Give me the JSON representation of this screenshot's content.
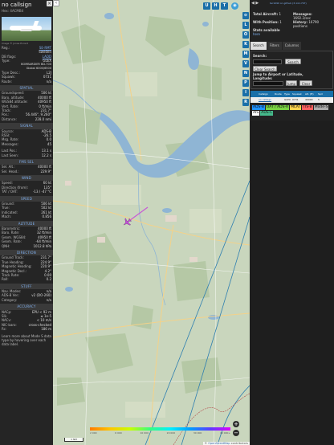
{
  "selected": {
    "callsign": "no callsign",
    "hex_label": "Hex:",
    "hex": "4ACMB4",
    "photo_credit": "Image © Jonas Evrard",
    "reg_label": "Reg.:",
    "reg": "SE-RMT",
    "country": "Sweden",
    "dbflags_label": "DB flags:",
    "dbflags": "LADD",
    "type_label": "Type:",
    "type": "GLEX",
    "typename": "BOMBARDIER BD-700 Global 6000/6500",
    "typedesc_label": "Type Desc.:",
    "typedesc": "L2J",
    "squawk_label": "Squawk:",
    "squawk": "0731",
    "route_label": "Route:",
    "route": "n/a",
    "sec_spatial": "SPATIAL",
    "spatial": [
      {
        "k": "Groundspeed:",
        "v": "506 kt"
      },
      {
        "k": "Baro. altitude:",
        "v": "40000 ft"
      },
      {
        "k": "WGS84 altitude:",
        "v": "40950 ft"
      },
      {
        "k": "Vert. Rate:",
        "v": "0 ft/min"
      },
      {
        "k": "Track:",
        "v": "231.7°"
      },
      {
        "k": "Pos.:",
        "v": "56.446°, 9.260°"
      },
      {
        "k": "Distance:",
        "v": "228.0 nmi"
      }
    ],
    "sec_signal": "SIGNAL",
    "signal": [
      {
        "k": "Source:",
        "v": "ADS-B"
      },
      {
        "k": "RSSI:",
        "v": "-26.5"
      },
      {
        "k": "Msg. Rate:",
        "v": "0.0"
      },
      {
        "k": "Messages:",
        "v": "45"
      }
    ],
    "signal2": [
      {
        "k": "Last Pos.:",
        "v": "13.1 s"
      },
      {
        "k": "Last Seen:",
        "v": "12.2 s"
      }
    ],
    "sec_fms": "FMS SEL",
    "fms": [
      {
        "k": "Sel. Alt.:",
        "v": "40000 ft"
      },
      {
        "k": "Sel. Head.:",
        "v": "229.9°"
      }
    ],
    "sec_wind": "WIND",
    "wind": [
      {
        "k": "Speed:",
        "v": "60 kt"
      },
      {
        "k": "Direction (from):",
        "v": "135°"
      },
      {
        "k": "TAT / OAT:",
        "v": "-13 / -47 °C"
      }
    ],
    "sec_speed": "SPEED",
    "speed": [
      {
        "k": "Ground:",
        "v": "506 kt"
      },
      {
        "k": "True:",
        "v": "502 kt"
      },
      {
        "k": "Indicated:",
        "v": "261 kt"
      },
      {
        "k": "Mach:",
        "v": "0.856"
      }
    ],
    "sec_altitude": "ALTITUDE",
    "altitude": [
      {
        "k": "Barometric:",
        "v": "40000 ft"
      },
      {
        "k": "Baro. Rate:",
        "v": "32 ft/min"
      },
      {
        "k": "Geom. WGS84:",
        "v": "40950 ft"
      },
      {
        "k": "Geom. Rate:",
        "v": "-64 ft/min"
      },
      {
        "k": "QNH:",
        "v": "1012.8 hPa"
      }
    ],
    "sec_direction": "DIRECTION",
    "direction": [
      {
        "k": "Ground Track:",
        "v": "231.7°"
      },
      {
        "k": "True Heading:",
        "v": "224.9°"
      },
      {
        "k": "Magnetic Heading:",
        "v": "220.9°"
      },
      {
        "k": "Magnetic Decl.:",
        "v": "4.2°"
      },
      {
        "k": "Track Rate:",
        "v": "0.00"
      },
      {
        "k": "Roll:",
        "v": "0.2"
      }
    ],
    "sec_stuff": "STUFF",
    "stuff": [
      {
        "k": "Nav. Modes:",
        "v": "n/a"
      },
      {
        "k": "ADS-B Ver.:",
        "v": "v2 (DO-260)"
      },
      {
        "k": "Category:",
        "v": "n/a"
      }
    ],
    "sec_accuracy": "ACCURACY",
    "accuracy": [
      {
        "k": "NACp:",
        "v": "EPU < 92 m"
      },
      {
        "k": "SIL:",
        "v": "≤ 1e-5"
      },
      {
        "k": "NACv:",
        "v": "< 10 m/s"
      },
      {
        "k": "NIC-baro:",
        "v": "cross-checked"
      },
      {
        "k": "Rc:",
        "v": "186 m"
      }
    ],
    "footer_text": "Learn more about Mode S data type by hovering over each data label."
  },
  "map": {
    "zoom_in": "+",
    "zoom_out": "−",
    "scale_label": "1 NM",
    "attribution_prefix": "©",
    "attribution_link": "OpenStreetMap",
    "attribution_suffix": "contributors",
    "alt_ticks": [
      "2 000",
      "6 000",
      "10 000",
      "20 000",
      "30 000",
      "40 000+"
    ],
    "side_buttons": [
      "⊙",
      "L",
      "O",
      "K",
      "M",
      "V",
      "N",
      "P",
      "I",
      "R"
    ],
    "top_buttons": [
      "U",
      "H",
      "T"
    ]
  },
  "right": {
    "link_text": "tar1090 on github (3.14.1707)",
    "nav_arrows": "◀ ▶",
    "stats": {
      "total_label": "Total Aircraft:",
      "total": "1",
      "messages_label": "Messages:",
      "messages": "1692.2/sec",
      "withpos_label": "With Position:",
      "withpos": "1",
      "history_label": "History:",
      "history": "16790 positions",
      "stats_label": "Stats available",
      "stats_link": "here"
    },
    "tabs": [
      "Search",
      "Filters",
      "Columns"
    ],
    "search_label": "Search:",
    "search_button": "Search",
    "clear_search_button": "Clear Search",
    "jump_label": "Jump to Airport or Latitude, Longitude:",
    "jump_button": "Jump",
    "clear_button": "Clear",
    "table_headers": [
      "Callsign",
      "Route",
      "Type",
      "Squawk",
      "Alt. (ft)",
      "Spd"
    ],
    "table_row": {
      "callsign": "no callsign",
      "route": "",
      "type": "GLEX",
      "squawk": "0731",
      "alt": "40000",
      "spd": "5"
    },
    "sources": [
      {
        "label": "ADS-B",
        "color": "#1e90ff"
      },
      {
        "label": "UAT / ADS-R",
        "color": "#79d143"
      },
      {
        "label": "MLAT",
        "color": "#ffd34e"
      },
      {
        "label": "TIS-B",
        "color": "#ff6060"
      },
      {
        "label": "Mode-S",
        "color": "#aaaaaa"
      },
      {
        "label": "AIS",
        "color": "#ffffff"
      },
      {
        "label": "ADS-C",
        "color": "#46ba8c"
      }
    ]
  }
}
